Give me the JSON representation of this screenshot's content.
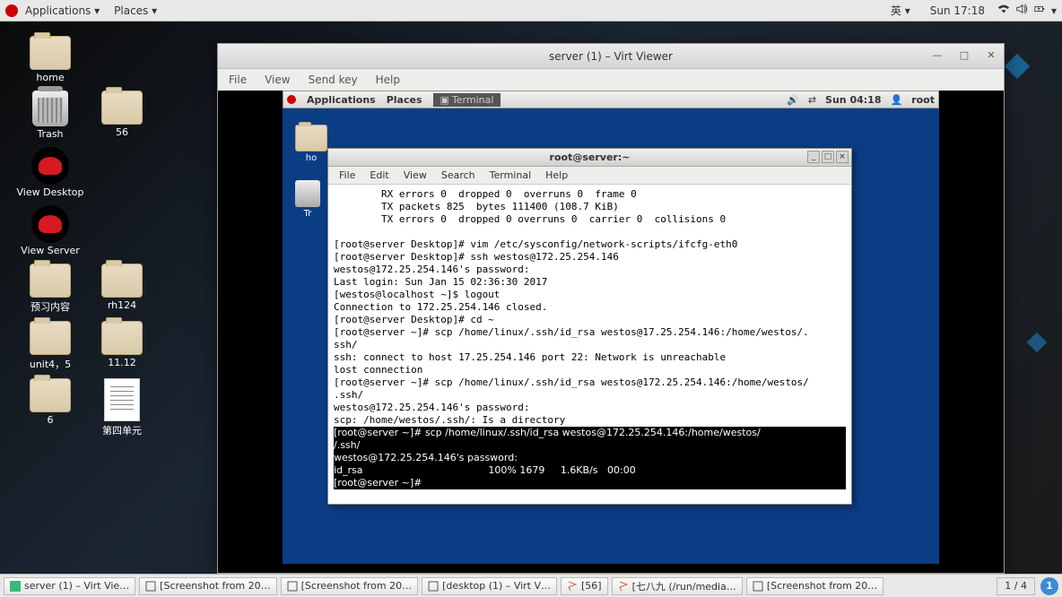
{
  "top": {
    "applications": "Applications ▾",
    "places": "Places ▾",
    "ime": "英 ▾",
    "clock": "Sun 17:18"
  },
  "desktop_icons": [
    {
      "type": "folder",
      "label": "home"
    },
    {
      "type": "none",
      "label": ""
    },
    {
      "type": "trash",
      "label": "Trash"
    },
    {
      "type": "folder",
      "label": "56"
    },
    {
      "type": "rh",
      "label": "View Desktop"
    },
    {
      "type": "none",
      "label": ""
    },
    {
      "type": "rh",
      "label": "View Server"
    },
    {
      "type": "none",
      "label": ""
    },
    {
      "type": "folder",
      "label": "预习内容"
    },
    {
      "type": "folder",
      "label": "rh124"
    },
    {
      "type": "folder",
      "label": "unit4，5"
    },
    {
      "type": "folder",
      "label": "11.12"
    },
    {
      "type": "folder",
      "label": "6"
    },
    {
      "type": "doc",
      "label": "第四单元"
    }
  ],
  "vv": {
    "title": "server (1) – Virt Viewer",
    "menu": [
      "File",
      "View",
      "Send key",
      "Help"
    ]
  },
  "guest": {
    "top": {
      "applications": "Applications",
      "places": "Places",
      "tab": "Terminal",
      "clock": "Sun 04:18",
      "user": "root"
    },
    "icons": [
      {
        "type": "folder",
        "label": "ho"
      },
      {
        "type": "trash",
        "label": "Tr"
      }
    ]
  },
  "term": {
    "title": "root@server:~",
    "menu": [
      "File",
      "Edit",
      "View",
      "Search",
      "Terminal",
      "Help"
    ],
    "lines": [
      "        RX errors 0  dropped 0  overruns 0  frame 0",
      "        TX packets 825  bytes 111400 (108.7 KiB)",
      "        TX errors 0  dropped 0 overruns 0  carrier 0  collisions 0",
      "",
      "[root@server Desktop]# vim /etc/sysconfig/network-scripts/ifcfg-eth0",
      "[root@server Desktop]# ssh westos@172.25.254.146",
      "westos@172.25.254.146's password:",
      "Last login: Sun Jan 15 02:36:30 2017",
      "[westos@localhost ~]$ logout",
      "Connection to 172.25.254.146 closed.",
      "[root@server Desktop]# cd ~",
      "[root@server ~]# scp /home/linux/.ssh/id_rsa westos@17.25.254.146:/home/westos/.",
      "ssh/",
      "ssh: connect to host 17.25.254.146 port 22: Network is unreachable",
      "lost connection",
      "[root@server ~]# scp /home/linux/.ssh/id_rsa westos@172.25.254.146:/home/westos/",
      ".ssh/",
      "westos@172.25.254.146's password:",
      "scp: /home/westos/.ssh/: Is a directory"
    ],
    "inv": [
      "[root@server ~]# scp /home/linux/.ssh/id_rsa westos@172.25.254.146:/home/westos/",
      "/.ssh/                                                                          ",
      "westos@172.25.254.146's password:                                               ",
      "id_rsa                                        100% 1679     1.6KB/s   00:00     ",
      "[root@server ~]#                                                                "
    ]
  },
  "bottom": {
    "tasks": [
      "server (1) – Virt Vie…",
      "[Screenshot from 20…",
      "[Screenshot from 20…",
      "[desktop (1) – Virt V…",
      "[56]",
      "[七八九 (/run/media…",
      "[Screenshot from 20…"
    ],
    "ws": "1 / 4",
    "notif": "1"
  }
}
